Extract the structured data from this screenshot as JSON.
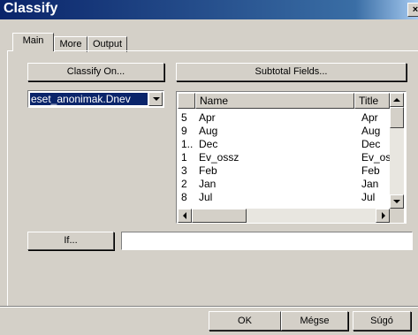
{
  "window": {
    "title": "Classify",
    "close_glyph": "×"
  },
  "tabs": [
    {
      "label": "Main",
      "active": true
    },
    {
      "label": "More",
      "active": false
    },
    {
      "label": "Output",
      "active": false
    }
  ],
  "main": {
    "classify_on_label": "Classify On...",
    "subtotal_fields_label": "Subtotal Fields...",
    "field_select": {
      "value": "eset_anonimak.Dnev"
    },
    "grid": {
      "columns": [
        "",
        "Name",
        "Title"
      ],
      "rows": [
        {
          "idx": "5",
          "name": "Apr",
          "title": "Apr"
        },
        {
          "idx": "9",
          "name": "Aug",
          "title": "Aug"
        },
        {
          "idx": "1..",
          "name": "Dec",
          "title": "Dec"
        },
        {
          "idx": "1",
          "name": "Ev_ossz",
          "title": "Ev_os"
        },
        {
          "idx": "3",
          "name": "Feb",
          "title": "Feb"
        },
        {
          "idx": "2",
          "name": "Jan",
          "title": "Jan"
        },
        {
          "idx": "8",
          "name": "Jul",
          "title": "Jul"
        }
      ]
    },
    "if_button_label": "If...",
    "if_expression": ""
  },
  "footer": {
    "ok_label": "OK",
    "cancel_label": "Mégse",
    "help_label": "Súgó"
  },
  "icons": [
    "close-icon",
    "dropdown-arrow-icon",
    "scroll-up-icon",
    "scroll-down-icon",
    "scroll-left-icon",
    "scroll-right-icon"
  ]
}
